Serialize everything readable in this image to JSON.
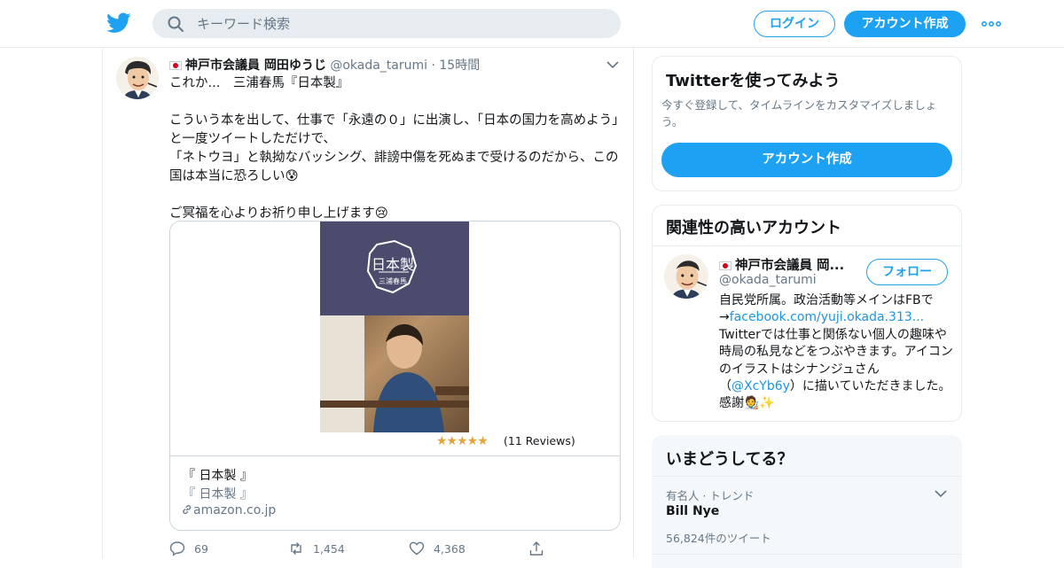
{
  "header": {
    "search_placeholder": "キーワード検索",
    "login_label": "ログイン",
    "signup_label": "アカウント作成",
    "brand_color": "#1da1f2"
  },
  "tweet": {
    "display_name": "神戸市会議員 岡田ゆうじ",
    "handle": "@okada_tarumi",
    "separator": "·",
    "time": "15時間",
    "text": "これか...　三浦春馬『日本製』\n\nこういう本を出して、仕事で「永遠の０」に出演し、「日本の国力を高めよう」と一度ツイートしただけで、\n「ネトウヨ」と執拗なバッシング、誹謗中傷を死ぬまで受けるのだから、この国は本当に恐ろしい😰\n\nご冥福を心よりお祈り申し上げます😢",
    "card": {
      "book_cover_title": "日本製",
      "book_cover_author": "三浦春馬",
      "stars": "★★★★★",
      "rating": 4.5,
      "reviews": "(11 Reviews)",
      "title": "『 日本製 』",
      "description": "『 日本製 』",
      "domain": "amazon.co.jp"
    },
    "actions": {
      "replies": "69",
      "retweets": "1,454",
      "likes": "4,368"
    }
  },
  "signup_box": {
    "title": "Twitterを使ってみよう",
    "subtitle": "今すぐ登録して、タイムラインをカスタマイズしましょう。",
    "button_label": "アカウント作成"
  },
  "related": {
    "title": "関連性の高いアカウント",
    "account_name": "神戸市会議員 岡...",
    "account_handle": "@okada_tarumi",
    "follow_label": "フォロー",
    "bio_1": "自民党所属。政治活動等メインはFBで→",
    "bio_link": "facebook.com/yuji.okada.313...",
    "bio_2": "Twitterでは仕事と関係ない個人の趣味や時局の私見などをつぶやきます。アイコンのイラストはシナンジュさん（",
    "bio_mention": "@XcYb6y",
    "bio_3": "）に描いていただきました。感謝🧑‍🎨✨"
  },
  "trends": {
    "title": "いまどうしてる？",
    "category": "有名人 · トレンド",
    "trend_name": "Bill Nye",
    "tweet_count": "56,824件のツイート"
  }
}
